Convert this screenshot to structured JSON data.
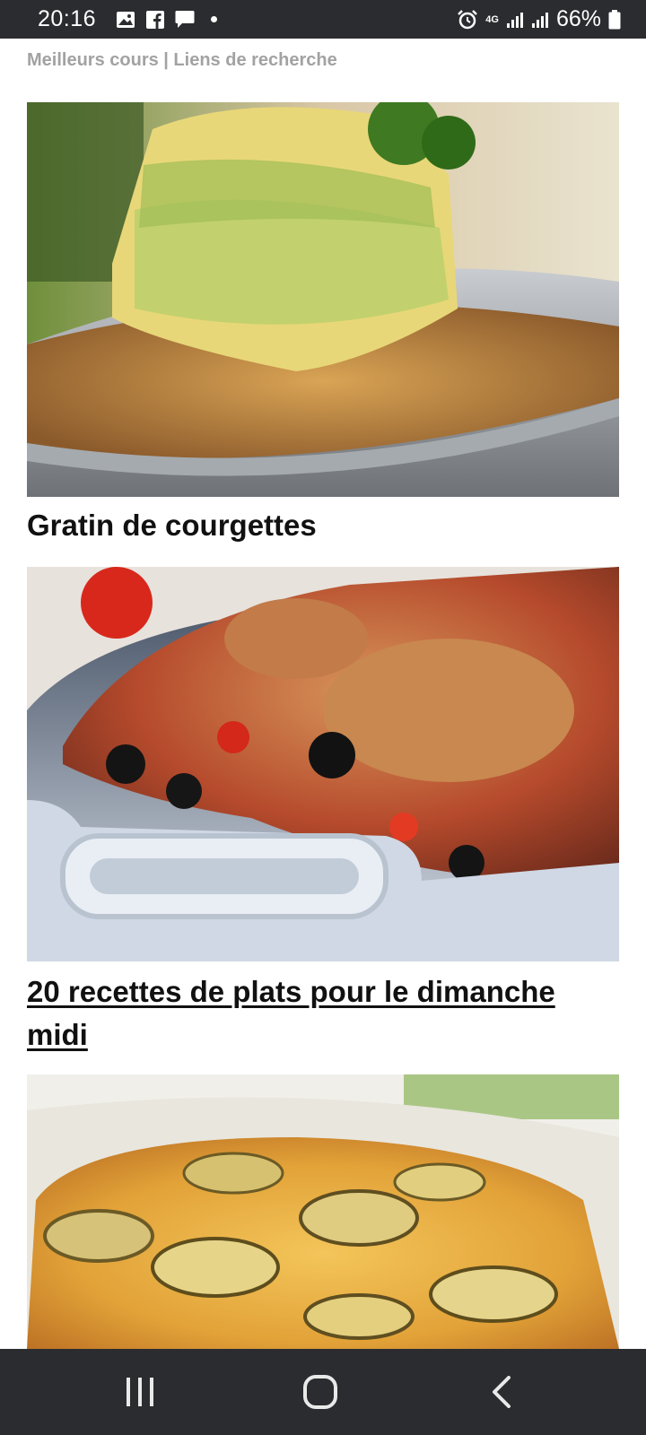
{
  "status_bar": {
    "time": "20:16",
    "battery": "66%",
    "network": "4G",
    "left_icons": [
      "gallery-icon",
      "facebook-icon",
      "message-icon",
      "dot-icon"
    ],
    "right_icons": [
      "alarm-icon",
      "network-4g-icon",
      "signal-icon",
      "signal-icon",
      "battery-icon"
    ]
  },
  "page": {
    "header": "Meilleurs cours | Liens de recherche",
    "cards": [
      {
        "image": "gratin-zucchini-photo",
        "title": "Gratin de courgettes",
        "link": false
      },
      {
        "image": "chicken-drumsticks-tomato-olives-photo",
        "title": "20 recettes de plats pour le dimanche midi",
        "link": true
      },
      {
        "image": "zucchini-frittata-photo",
        "title": "",
        "link": false
      }
    ]
  },
  "nav_bar": {
    "buttons": [
      "recent-apps",
      "home",
      "back"
    ]
  },
  "colors": {
    "system_bar": "#2b2c30",
    "header_text": "#a2a2a2",
    "title_text": "#111111"
  }
}
